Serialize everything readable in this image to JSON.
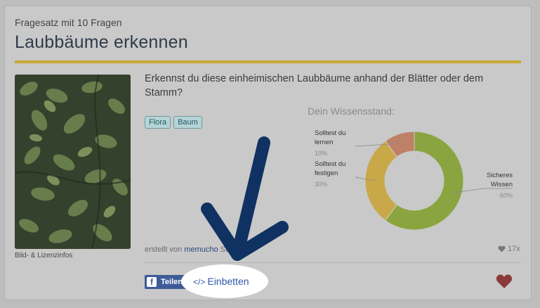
{
  "card": {
    "kicker": "Fragesatz mit 10 Fragen",
    "title": "Laubbäume erkennen",
    "image_caption": "Bild- & Lizenzinfos",
    "description": "Erkennst du diese einheimischen Laubbäume anhand der Blätter oder dem Stamm?",
    "tags": [
      "Flora",
      "Baum"
    ],
    "created_prefix": "erstellt von",
    "created_by": "memucho",
    "created_suffix": "Stiften",
    "likes": "17x"
  },
  "knowledge": {
    "title": "Dein Wissensstand:"
  },
  "chart_data": {
    "type": "pie",
    "title": "Dein Wissensstand:",
    "slices": [
      {
        "label": "Sicheres Wissen",
        "lines": [
          "Sicheres",
          "Wissen"
        ],
        "value": 60,
        "pct_label": "60%",
        "color": "#8aa53f"
      },
      {
        "label": "Solltest du festigen",
        "lines": [
          "Solltest du",
          "festigen"
        ],
        "value": 30,
        "pct_label": "30%",
        "color": "#c9a84a"
      },
      {
        "label": "Solltest du lernen",
        "lines": [
          "Solltest du",
          "lernen"
        ],
        "value": 10,
        "pct_label": "10%",
        "color": "#bf8068"
      }
    ]
  },
  "actions": {
    "share_label": "Teilen",
    "share_icon": "f",
    "embed_code_glyph": "</>",
    "embed_label": "Einbetten"
  },
  "colors": {
    "accent_bar": "#c9a733",
    "arrow": "#103262",
    "heart": "#8a3a3a",
    "facebook": "#3f5b97"
  }
}
